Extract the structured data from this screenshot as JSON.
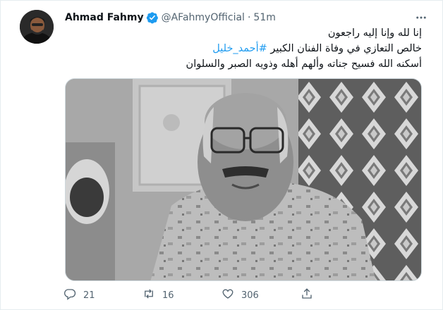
{
  "tweet": {
    "author": {
      "name": "Ahmad Fahmy",
      "handle": "@AFahmyOfficial",
      "separator": "·",
      "time": "51m"
    },
    "text": {
      "line1": "إنا لله وإنا إليه راجعون",
      "line2_prefix": "خالص التعازي في وفاة الفنان الكبير ",
      "hashtag": "#أحمد_خليل",
      "line3": "أسكنه الله فسيح جناته وألهم أهله وذويه الصبر والسلوان"
    },
    "stats": {
      "replies": "21",
      "retweets": "16",
      "likes": "306"
    }
  },
  "colors": {
    "accent": "#1d9bf0",
    "muted": "#536471",
    "text": "#0f1419"
  },
  "icons": {
    "verified": "verified-badge-icon",
    "more": "more-dots-icon",
    "reply": "reply-icon",
    "retweet": "retweet-icon",
    "like": "heart-icon",
    "share": "share-icon"
  }
}
